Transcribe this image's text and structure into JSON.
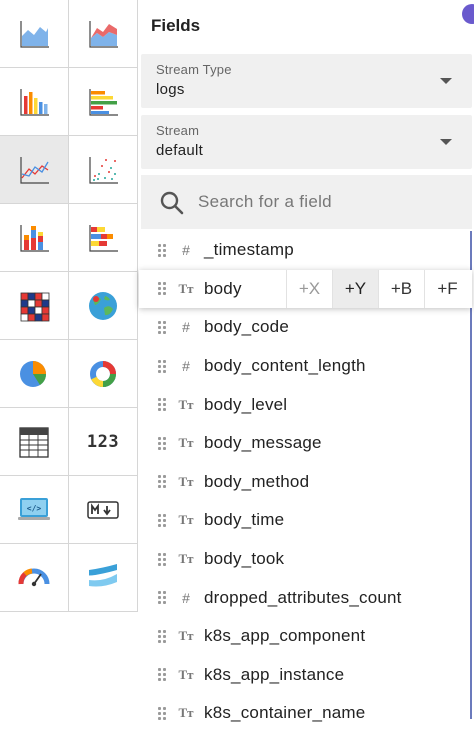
{
  "chart_types": [
    {
      "name": "area-chart-icon"
    },
    {
      "name": "stacked-area-chart-icon"
    },
    {
      "name": "bar-chart-icon"
    },
    {
      "name": "horizontal-bar-chart-icon"
    },
    {
      "name": "line-chart-icon",
      "active": true
    },
    {
      "name": "scatter-chart-icon"
    },
    {
      "name": "stacked-bar-chart-icon"
    },
    {
      "name": "horizontal-stacked-bar-chart-icon"
    },
    {
      "name": "heatmap-chart-icon"
    },
    {
      "name": "geomap-chart-icon"
    },
    {
      "name": "pie-chart-icon"
    },
    {
      "name": "donut-chart-icon"
    },
    {
      "name": "table-chart-icon"
    },
    {
      "name": "metric-chart-icon",
      "text": "123"
    },
    {
      "name": "html-chart-icon"
    },
    {
      "name": "markdown-chart-icon"
    },
    {
      "name": "gauge-chart-icon"
    },
    {
      "name": "sankey-chart-icon"
    }
  ],
  "colors": {
    "blue": "#4a90e2",
    "red": "#e53935",
    "orange": "#fb8c00",
    "green": "#43a047",
    "yellow": "#fdd835",
    "purple": "#6a5acd"
  },
  "fields_panel": {
    "title": "Fields",
    "stream_type": {
      "label": "Stream Type",
      "value": "logs"
    },
    "stream": {
      "label": "Stream",
      "value": "default"
    },
    "search": {
      "placeholder": "Search for a field",
      "value": ""
    },
    "axis_buttons": [
      "+X",
      "+Y",
      "+B",
      "+F"
    ],
    "fields": [
      {
        "name": "_timestamp",
        "type": "number"
      },
      {
        "name": "body",
        "type": "text",
        "hovered": true
      },
      {
        "name": "body_code",
        "type": "number"
      },
      {
        "name": "body_content_length",
        "type": "number"
      },
      {
        "name": "body_level",
        "type": "text"
      },
      {
        "name": "body_message",
        "type": "text"
      },
      {
        "name": "body_method",
        "type": "text"
      },
      {
        "name": "body_time",
        "type": "text"
      },
      {
        "name": "body_took",
        "type": "text"
      },
      {
        "name": "dropped_attributes_count",
        "type": "number"
      },
      {
        "name": "k8s_app_component",
        "type": "text"
      },
      {
        "name": "k8s_app_instance",
        "type": "text"
      },
      {
        "name": "k8s_container_name",
        "type": "text"
      }
    ]
  }
}
